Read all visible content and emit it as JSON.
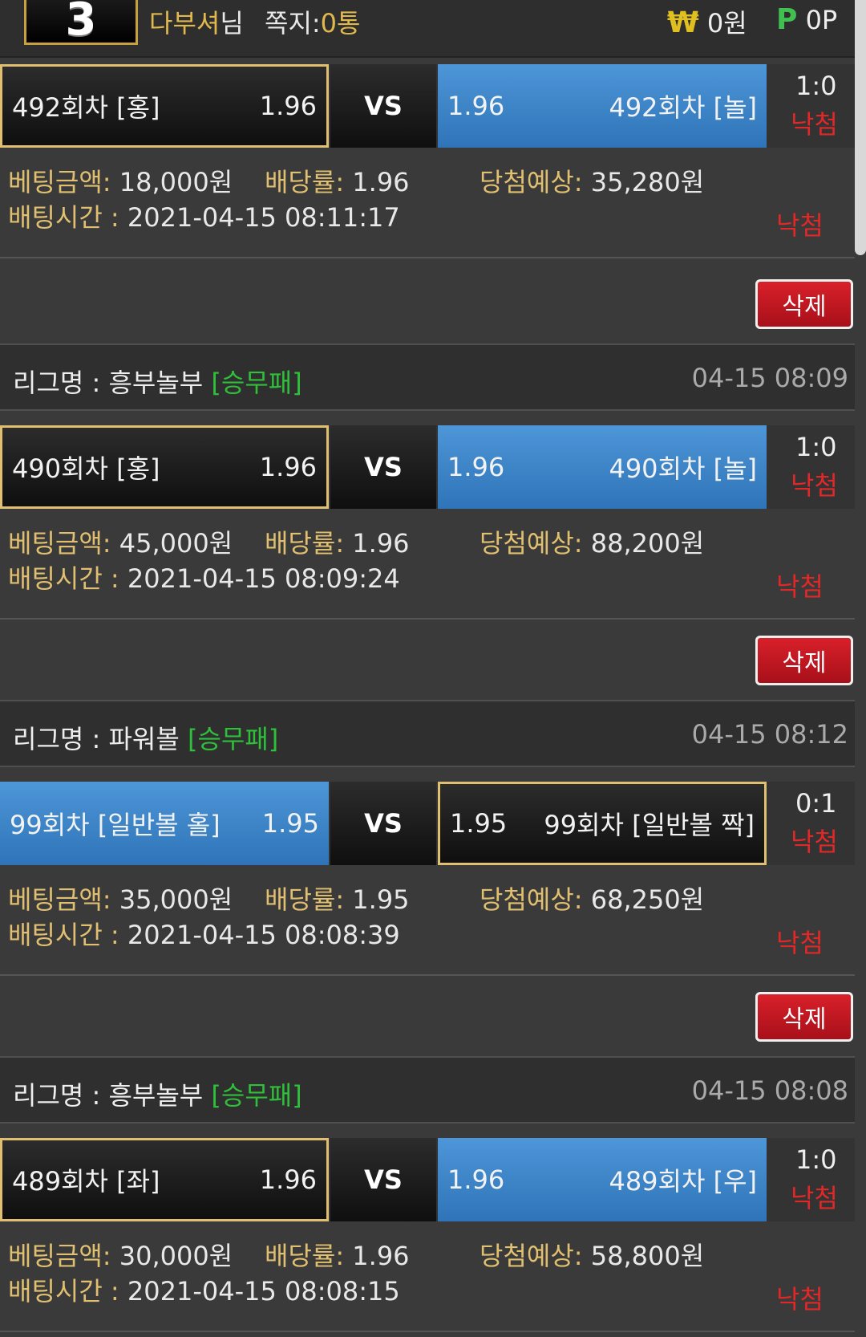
{
  "header": {
    "level": "3",
    "username": "다부셔",
    "username_suffix": "님",
    "message_label": "쪽지:",
    "message_count": "0통",
    "money_icon": "₩",
    "money": "0원",
    "point_icon": "P",
    "point": "0P"
  },
  "bets": [
    {
      "league": null,
      "league_tag": null,
      "time": null,
      "left_team": "492회차 [홍]",
      "left_odds": "1.96",
      "vs": "VS",
      "right_odds": "1.96",
      "right_team": "492회차 [놀]",
      "score": "1:0",
      "match_result": "낙첨",
      "bet_amount_label": "베팅금액:",
      "bet_amount": "18,000원",
      "odds_label": "배당률:",
      "odds": "1.96",
      "expected_label": "당첨예상:",
      "expected": "35,280원",
      "bet_time_label": "배팅시간 :",
      "bet_time": "2021-04-15 08:11:17",
      "bet_result": "낙첨",
      "delete_label": "삭제"
    },
    {
      "league_label": "리그명 :",
      "league": "흥부놀부",
      "league_tag": "[승무패]",
      "time": "04-15 08:09",
      "left_team": "490회차 [홍]",
      "left_odds": "1.96",
      "vs": "VS",
      "right_odds": "1.96",
      "right_team": "490회차 [놀]",
      "score": "1:0",
      "match_result": "낙첨",
      "bet_amount_label": "베팅금액:",
      "bet_amount": "45,000원",
      "odds_label": "배당률:",
      "odds": "1.96",
      "expected_label": "당첨예상:",
      "expected": "88,200원",
      "bet_time_label": "배팅시간 :",
      "bet_time": "2021-04-15 08:09:24",
      "bet_result": "낙첨",
      "delete_label": "삭제"
    },
    {
      "league_label": "리그명 :",
      "league": "파워볼",
      "league_tag": "[승무패]",
      "time": "04-15 08:12",
      "left_team": "99회차 [일반볼 홀]",
      "left_odds": "1.95",
      "vs": "VS",
      "right_odds": "1.95",
      "right_team": "99회차 [일반볼 짝]",
      "score": "0:1",
      "match_result": "낙첨",
      "bet_amount_label": "베팅금액:",
      "bet_amount": "35,000원",
      "odds_label": "배당률:",
      "odds": "1.95",
      "expected_label": "당첨예상:",
      "expected": "68,250원",
      "bet_time_label": "배팅시간 :",
      "bet_time": "2021-04-15 08:08:39",
      "bet_result": "낙첨",
      "delete_label": "삭제"
    },
    {
      "league_label": "리그명 :",
      "league": "흥부놀부",
      "league_tag": "[승무패]",
      "time": "04-15 08:08",
      "left_team": "489회차 [좌]",
      "left_odds": "1.96",
      "vs": "VS",
      "right_odds": "1.96",
      "right_team": "489회차 [우]",
      "score": "1:0",
      "match_result": "낙첨",
      "bet_amount_label": "베팅금액:",
      "bet_amount": "30,000원",
      "odds_label": "배당률:",
      "odds": "1.96",
      "expected_label": "당첨예상:",
      "expected": "58,800원",
      "bet_time_label": "배팅시간 :",
      "bet_time": "2021-04-15 08:08:15",
      "bet_result": "낙첨"
    }
  ],
  "colors": {
    "accent_gold": "#e0c070",
    "lose_red": "#e02828",
    "tag_green": "#2fbf3a",
    "blue": "#3f86cc"
  }
}
